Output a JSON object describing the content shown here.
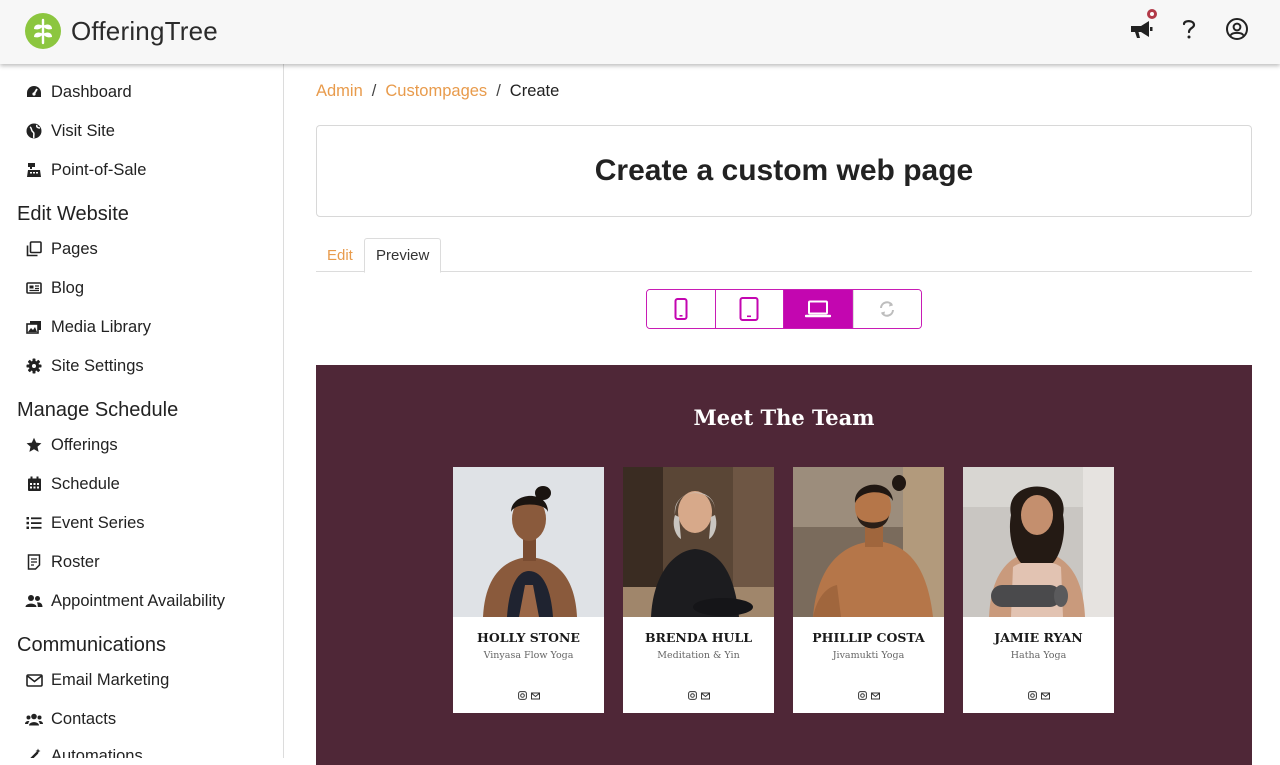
{
  "app": {
    "name": "OfferingTree"
  },
  "sidebar": {
    "top_items": [
      {
        "label": "Dashboard",
        "icon": "dashboard-gauge-icon"
      },
      {
        "label": "Visit Site",
        "icon": "globe-icon"
      },
      {
        "label": "Point-of-Sale",
        "icon": "cash-register-icon"
      }
    ],
    "sections": [
      {
        "title": "Edit Website",
        "items": [
          {
            "label": "Pages",
            "icon": "pages-icon"
          },
          {
            "label": "Blog",
            "icon": "newspaper-icon"
          },
          {
            "label": "Media Library",
            "icon": "images-icon"
          },
          {
            "label": "Site Settings",
            "icon": "gear-icon"
          }
        ]
      },
      {
        "title": "Manage Schedule",
        "items": [
          {
            "label": "Offerings",
            "icon": "star-icon"
          },
          {
            "label": "Schedule",
            "icon": "calendar-icon"
          },
          {
            "label": "Event Series",
            "icon": "list-icon"
          },
          {
            "label": "Roster",
            "icon": "roster-icon"
          },
          {
            "label": "Appointment Availability",
            "icon": "users-icon"
          }
        ]
      },
      {
        "title": "Communications",
        "items": [
          {
            "label": "Email Marketing",
            "icon": "envelope-icon"
          },
          {
            "label": "Contacts",
            "icon": "contacts-icon"
          },
          {
            "label": "Automations",
            "icon": "magic-wand-icon"
          }
        ]
      }
    ]
  },
  "breadcrumb": {
    "admin": "Admin",
    "custompages": "Custompages",
    "current": "Create",
    "sep": "/"
  },
  "page": {
    "title": "Create a custom web page"
  },
  "tabs": {
    "edit": "Edit",
    "preview": "Preview",
    "active": "Preview"
  },
  "device_toggle": {
    "options": [
      "mobile-icon",
      "tablet-icon",
      "laptop-icon",
      "refresh-icon"
    ],
    "active": "laptop-icon"
  },
  "preview": {
    "heading": "Meet The Team",
    "team": [
      {
        "name": "HOLLY STONE",
        "role": "Vinyasa Flow Yoga"
      },
      {
        "name": "BRENDA HULL",
        "role": "Meditation & Yin"
      },
      {
        "name": "PHILLIP COSTA",
        "role": "Jivamukti Yoga"
      },
      {
        "name": "JAMIE RYAN",
        "role": "Hatha Yoga"
      }
    ]
  },
  "colors": {
    "accent": "#c306b0",
    "link": "#e89b4c",
    "preview_bg": "#4f2737",
    "logo_green": "#8cc63f",
    "notification": "#b23a48"
  }
}
